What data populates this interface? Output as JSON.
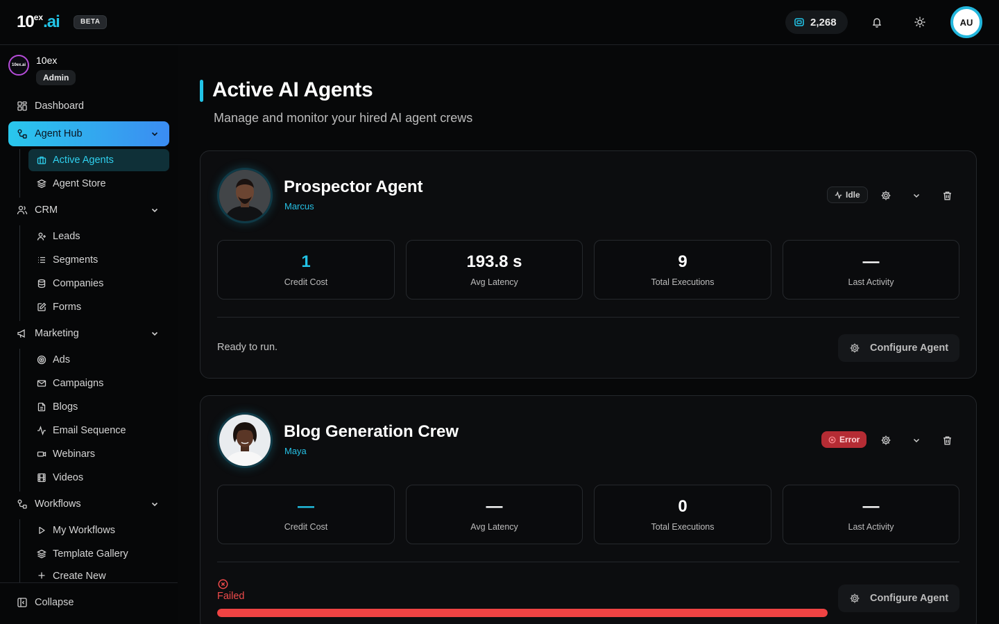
{
  "header": {
    "logo_main": "10",
    "logo_sup": "ex",
    "logo_ai": ".ai",
    "beta": "BETA",
    "credits": "2,268",
    "user_initials": "AU"
  },
  "sidebar": {
    "org_logo_text": "10ex.ai",
    "org_name": "10ex",
    "role": "Admin",
    "items": {
      "dashboard": "Dashboard",
      "agent_hub": "Agent Hub",
      "active_agents": "Active Agents",
      "agent_store": "Agent Store",
      "crm": "CRM",
      "leads": "Leads",
      "segments": "Segments",
      "companies": "Companies",
      "forms": "Forms",
      "marketing": "Marketing",
      "ads": "Ads",
      "campaigns": "Campaigns",
      "blogs": "Blogs",
      "email_sequence": "Email Sequence",
      "webinars": "Webinars",
      "videos": "Videos",
      "workflows": "Workflows",
      "my_workflows": "My Workflows",
      "template_gallery": "Template Gallery",
      "create_new": "Create New"
    },
    "collapse": "Collapse"
  },
  "main": {
    "title": "Active AI Agents",
    "subtitle": "Manage and monitor your hired AI agent crews"
  },
  "agents": [
    {
      "name": "Prospector Agent",
      "person": "Marcus",
      "status": "Idle",
      "stats": [
        {
          "value": "1",
          "label": "Credit Cost"
        },
        {
          "value": "193.8 s",
          "label": "Avg Latency"
        },
        {
          "value": "9",
          "label": "Total Executions"
        },
        {
          "value": "—",
          "label": "Last Activity"
        }
      ],
      "message": "Ready to run.",
      "configure": "Configure Agent"
    },
    {
      "name": "Blog Generation Crew",
      "person": "Maya",
      "status": "Error",
      "stats": [
        {
          "value": "—",
          "label": "Credit Cost"
        },
        {
          "value": "—",
          "label": "Avg Latency"
        },
        {
          "value": "0",
          "label": "Total Executions"
        },
        {
          "value": "—",
          "label": "Last Activity"
        }
      ],
      "message": "Failed",
      "progress": 1.0,
      "configure": "Configure Agent"
    }
  ],
  "colors": {
    "accent": "#22c3e6",
    "error": "#ef4343",
    "background": "#070809"
  }
}
